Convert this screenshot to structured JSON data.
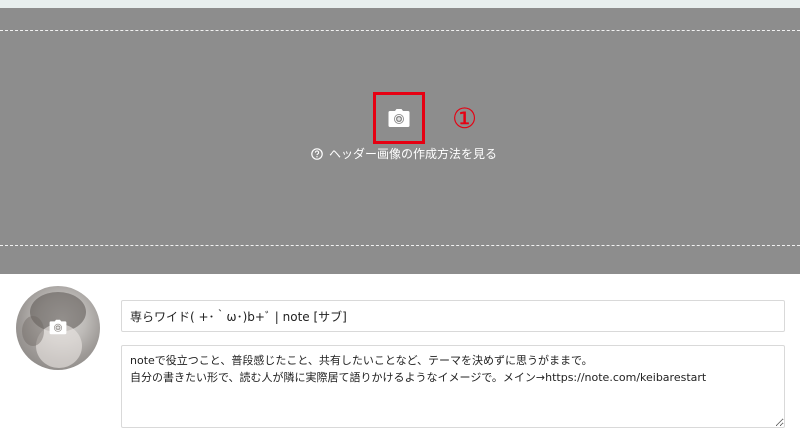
{
  "header": {
    "help_link_label": "ヘッダー画像の作成方法を見る",
    "annotation_number": "①",
    "annotation_color": "#e60012"
  },
  "profile": {
    "title_value": "専らワイド( +･｀ω･)b+ﾞ | note [サブ]",
    "bio_value": "noteで役立つこと、普段感じたこと、共有したいことなど、テーマを決めずに思うがままで。\n自分の書きたい形で、読む人が隣に実際居て語りかけるようなイメージで。メイン→https://note.com/keibarestart"
  },
  "icons": {
    "header_upload": "camera-plus-icon",
    "help": "question-circle-icon",
    "avatar_upload": "camera-plus-icon"
  },
  "colors": {
    "header_background": "#8d8d8d",
    "highlight_border": "#e60012"
  }
}
